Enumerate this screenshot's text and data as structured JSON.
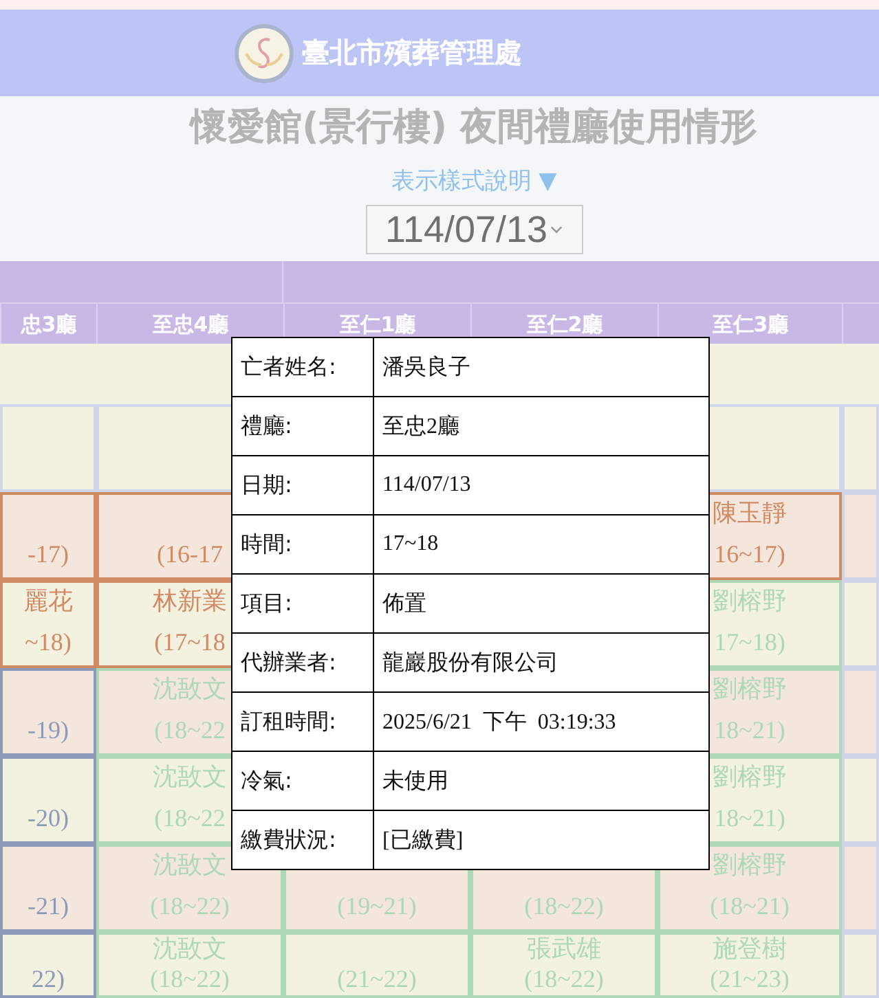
{
  "header": {
    "title": "臺北市殯葬管理處"
  },
  "page_title": "懷愛館(景行樓) 夜間禮廳使用情形",
  "legend_link": "表示樣式說明 ▼",
  "date_select": {
    "value": "114/07/13"
  },
  "columns": [
    "忠3廳",
    "至忠4廳",
    "至仁1廳",
    "至仁2廳",
    "至仁3廳"
  ],
  "rows": [
    {
      "cells": [
        {},
        {},
        {},
        {},
        {},
        {}
      ]
    },
    {
      "cells": [
        {
          "time": "-17)",
          "color": "#d08a64"
        },
        {
          "time": "(16-17",
          "color": "#d08a64"
        },
        {},
        {},
        {
          "name": "陳玉靜",
          "time": "16~17)",
          "color": "#d08a64"
        },
        {}
      ]
    },
    {
      "cells": [
        {
          "name": "麗花",
          "time": "~18)",
          "color": "#d08a64"
        },
        {
          "name": "林新業",
          "time": "(17~18",
          "color": "#d08a64"
        },
        {},
        {},
        {
          "name": "劉榕野",
          "time": "17~18)",
          "color": "#acd8b6"
        },
        {}
      ]
    },
    {
      "cells": [
        {
          "time": "-19)",
          "color": "#8a9ab8"
        },
        {
          "name": "沈敔文",
          "time": "(18~22",
          "color": "#acd8b6"
        },
        {},
        {},
        {
          "name": "劉榕野",
          "time": "18~21)",
          "color": "#acd8b6"
        },
        {}
      ]
    },
    {
      "cells": [
        {
          "time": "-20)",
          "color": "#8a9ab8"
        },
        {
          "name": "沈敔文",
          "time": "(18~22",
          "color": "#acd8b6"
        },
        {},
        {},
        {
          "name": "劉榕野",
          "time": "18~21)",
          "color": "#acd8b6"
        },
        {}
      ]
    },
    {
      "cells": [
        {
          "time": "-21)",
          "color": "#8a9ab8"
        },
        {
          "name": "沈敔文",
          "time": "(18~22)",
          "color": "#acd8b6"
        },
        {
          "time": "(19~21)",
          "color": "#acd8b6"
        },
        {
          "time": "(18~22)",
          "color": "#acd8b6"
        },
        {
          "name": "劉榕野",
          "time": "(18~21)",
          "color": "#acd8b6"
        },
        {}
      ]
    },
    {
      "cells": [
        {
          "time": "22)",
          "color": "#8a9ab8"
        },
        {
          "name": "沈敔文",
          "time": "(18~22)",
          "color": "#acd8b6"
        },
        {
          "time": "(21~22)",
          "color": "#acd8b6"
        },
        {
          "name": "張武雄",
          "time": "(18~22)",
          "color": "#acd8b6"
        },
        {
          "name": "施登樹",
          "time": "(21~23)",
          "color": "#acd8b6"
        },
        {}
      ]
    }
  ],
  "popup": [
    {
      "label": "亡者姓名:",
      "value": "潘吳良子"
    },
    {
      "label": "禮廳:",
      "value": "至忠2廳"
    },
    {
      "label": "日期:",
      "value": "114/07/13"
    },
    {
      "label": "時間:",
      "value": "17~18"
    },
    {
      "label": "項目:",
      "value": "佈置"
    },
    {
      "label": "代辦業者:",
      "value": "龍巖股份有限公司"
    },
    {
      "label": "訂租時間:",
      "value": "2025/6/21  下午  03:19:33"
    },
    {
      "label": "冷氣:",
      "value": "未使用"
    },
    {
      "label": "繳費狀況:",
      "value": "[已繳費]"
    }
  ]
}
